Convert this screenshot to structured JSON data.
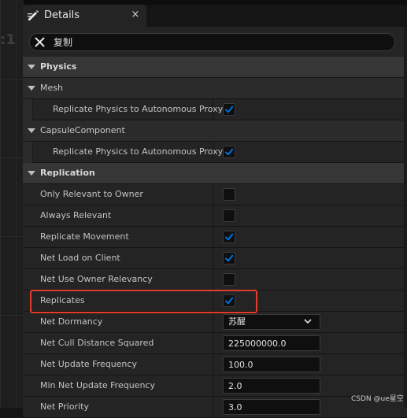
{
  "tab": {
    "title": "Details",
    "close_glyph": "×",
    "icon": "pencil-details-icon"
  },
  "background": {
    "partial_text": ":1"
  },
  "search": {
    "value": "复制",
    "clear_icon": "close-icon"
  },
  "categories": {
    "physics": "Physics",
    "mesh": "Mesh",
    "mesh_prop": "Replicate Physics to Autonomous Proxy",
    "capsule": "CapsuleComponent",
    "capsule_prop": "Replicate Physics to Autonomous Proxy",
    "replication": "Replication"
  },
  "checkbox_states": {
    "mesh_replicate_physics": true,
    "capsule_replicate_physics": true,
    "only_relevant_to_owner": false,
    "always_relevant": false,
    "replicate_movement": true,
    "net_load_on_client": true,
    "net_use_owner_relevancy": false,
    "replicates": true
  },
  "replication_props": {
    "only_relevant_to_owner": "Only Relevant to Owner",
    "always_relevant": "Always Relevant",
    "replicate_movement": "Replicate Movement",
    "net_load_on_client": "Net Load on Client",
    "net_use_owner_relevancy": "Net Use Owner Relevancy",
    "replicates": "Replicates",
    "net_dormancy": "Net Dormancy",
    "net_dormancy_value": "苏醒",
    "net_cull_distance_squared": "Net Cull Distance Squared",
    "net_cull_distance_squared_value": "225000000.0",
    "net_update_frequency": "Net Update Frequency",
    "net_update_frequency_value": "100.0",
    "min_net_update_frequency": "Min Net Update Frequency",
    "min_net_update_frequency_value": "2.0",
    "net_priority": "Net Priority",
    "net_priority_value": "3.0"
  },
  "watermark": "CSDN @ue星空",
  "colors": {
    "accent": "#0070e0",
    "highlight_border": "#e33a2e",
    "panel_bg": "#242424",
    "category_bg": "#363636"
  }
}
